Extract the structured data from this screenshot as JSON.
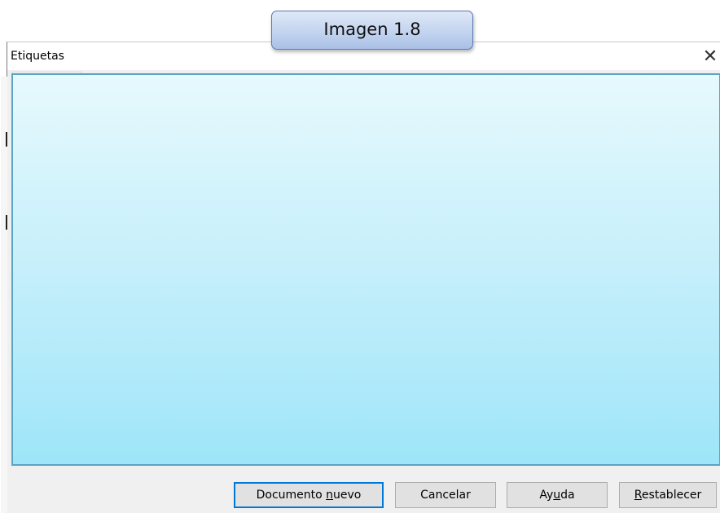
{
  "caption": {
    "text": "Imagen 1.8"
  },
  "dialog": {
    "title": "Etiquetas",
    "close_icon": "close-icon",
    "panel_colors": {
      "top": "#e6f9fd",
      "bottom": "#9ee5f9",
      "border": "#5aa4c4"
    },
    "buttons": {
      "new_document": {
        "before": "Documento ",
        "mnemonic": "n",
        "after": "uevo"
      },
      "cancel": {
        "label": "Cancelar"
      },
      "help": {
        "before": "Ay",
        "mnemonic": "u",
        "after": "da"
      },
      "reset": {
        "before": "",
        "mnemonic": "R",
        "after": "establecer"
      }
    },
    "accent_color": "#0078d7"
  }
}
